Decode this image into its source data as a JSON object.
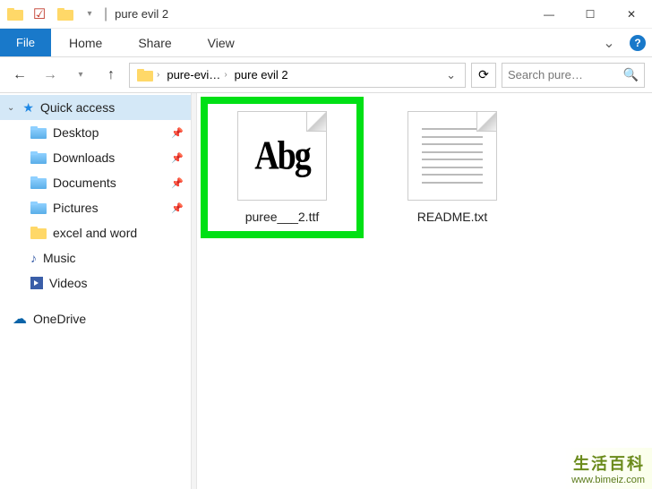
{
  "titlebar": {
    "title": "pure evil 2",
    "dropdown_glyph": "▾"
  },
  "window_buttons": {
    "minimize": "—",
    "maximize": "☐",
    "close": "✕"
  },
  "ribbon": {
    "file": "File",
    "tabs": [
      "Home",
      "Share",
      "View"
    ],
    "expand_glyph": "⌄",
    "help_glyph": "?"
  },
  "nav": {
    "back_glyph": "←",
    "forward_glyph": "→",
    "recent_glyph": "▾",
    "up_glyph": "↑",
    "refresh_glyph": "⟳"
  },
  "breadcrumb": {
    "items": [
      "pure-evi…",
      "pure evil 2"
    ],
    "chevron": "›",
    "dropdown": "⌄"
  },
  "search": {
    "placeholder": "Search pure…",
    "icon": "🔍"
  },
  "sidebar": {
    "quick_access": {
      "label": "Quick access",
      "collapse_glyph": "⌄"
    },
    "pinned": [
      {
        "label": "Desktop",
        "pinned": true
      },
      {
        "label": "Downloads",
        "pinned": true
      },
      {
        "label": "Documents",
        "pinned": true
      },
      {
        "label": "Pictures",
        "pinned": true
      }
    ],
    "recent": [
      {
        "label": "excel and word"
      },
      {
        "label": "Music"
      },
      {
        "label": "Videos"
      }
    ],
    "onedrive": {
      "label": "OneDrive"
    },
    "pin_glyph": "📌",
    "scroll_up": "▴"
  },
  "files": [
    {
      "name": "puree___2.ttf",
      "type": "font",
      "highlighted": true,
      "preview_text": "Abg"
    },
    {
      "name": "README.txt",
      "type": "text",
      "highlighted": false
    }
  ],
  "watermark": {
    "line1": "生活百科",
    "line2": "www.bimeiz.com"
  }
}
